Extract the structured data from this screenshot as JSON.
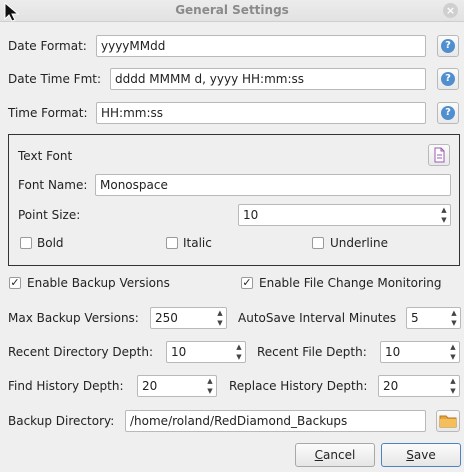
{
  "window": {
    "title": "General Settings",
    "close": "×"
  },
  "formats": {
    "date_label": "Date Format:",
    "date_value": "yyyyMMdd",
    "datetime_label": "Date Time Fmt:",
    "datetime_value": "dddd MMMM d, yyyy HH:mm:ss",
    "time_label": "Time Format:",
    "time_value": "HH:mm:ss",
    "help": "?"
  },
  "text_font": {
    "title": "Text Font",
    "font_name_label": "Font Name:",
    "font_name_value": "Monospace",
    "point_size_label": "Point Size:",
    "point_size_value": "10",
    "bold_label": "Bold",
    "italic_label": "Italic",
    "underline_label": "Underline",
    "bold_checked": false,
    "italic_checked": false,
    "underline_checked": false
  },
  "options": {
    "enable_backup_label": "Enable Backup Versions",
    "enable_backup_checked": true,
    "enable_monitoring_label": "Enable File Change Monitoring",
    "enable_monitoring_checked": true
  },
  "numbers": {
    "max_backup_label": "Max Backup Versions:",
    "max_backup_value": "250",
    "autosave_label": "AutoSave Interval Minutes",
    "autosave_value": "5",
    "recent_dir_label": "Recent Directory Depth:",
    "recent_dir_value": "10",
    "recent_file_label": "Recent File Depth:",
    "recent_file_value": "10",
    "find_history_label": "Find History Depth:",
    "find_history_value": "20",
    "replace_history_label": "Replace History Depth:",
    "replace_history_value": "20"
  },
  "backup_dir": {
    "label": "Backup Directory:",
    "value": "/home/roland/RedDiamond_Backups"
  },
  "buttons": {
    "cancel_first": "C",
    "cancel_rest": "ancel",
    "save_first": "S",
    "save_rest": "ave"
  },
  "arrows": {
    "up": "▲",
    "down": "▼",
    "check": "✓"
  }
}
